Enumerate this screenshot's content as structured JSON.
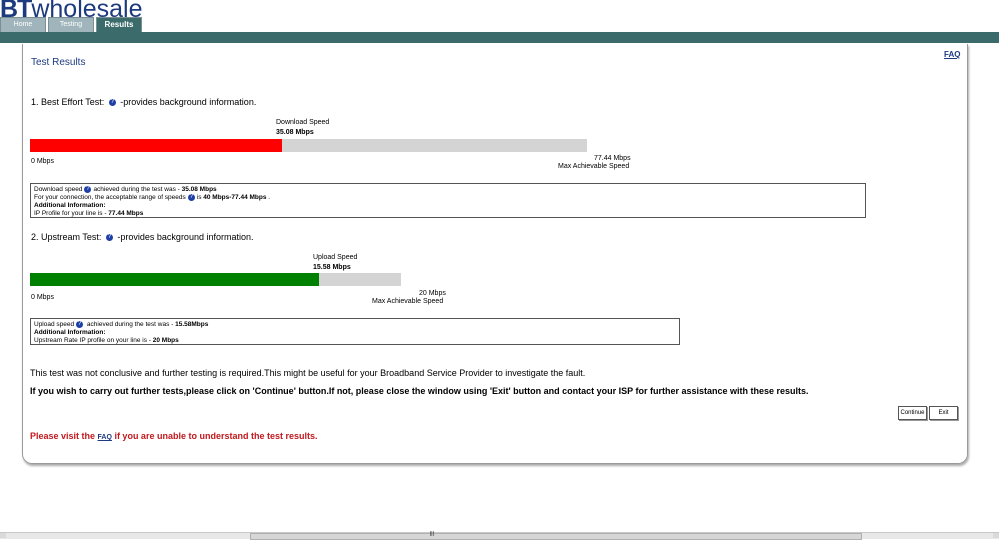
{
  "brand": {
    "bt": "BT",
    "name": "wholesale"
  },
  "tabs": [
    {
      "label": "Home"
    },
    {
      "label": "Testing"
    },
    {
      "label": "Results"
    }
  ],
  "faq_label": "FAQ",
  "title": "Test Results",
  "download": {
    "heading": "1. Best Effort Test:",
    "heading_suffix": "-provides background information.",
    "speed_label": "Download Speed",
    "speed_value": "35.08 Mbps",
    "min_label": "0 Mbps",
    "max_value": "77.44 Mbps",
    "max_label": "Max Achievable Speed",
    "fill_fraction": 0.453,
    "fill_color": "#ff0000",
    "info": {
      "line1_prefix": "Download speed",
      "line1_mid": "achieved during the test was - ",
      "line1_value": "35.08 Mbps",
      "line2_prefix": "For your connection, the acceptable range of speeds",
      "line2_mid": "is ",
      "line2_value": "40 Mbps-77.44 Mbps",
      "line2_suffix": " .",
      "line3": "Additional Information:",
      "line4_prefix": "IP Profile for your line is - ",
      "line4_value": "77.44 Mbps"
    }
  },
  "upload": {
    "heading": "2. Upstream Test:",
    "heading_suffix": "-provides background information.",
    "speed_label": "Upload Speed",
    "speed_value": "15.58 Mbps",
    "min_label": "0 Mbps",
    "max_value": "20 Mbps",
    "max_label": "Max Achievable Speed",
    "fill_fraction": 0.779,
    "fill_color": "#008000",
    "info": {
      "line1_prefix": "Upload speed",
      "line1_mid": " achieved during the test was - ",
      "line1_value": "15.58Mbps",
      "line2": "Additional Information:",
      "line3_prefix": "Upstream Rate IP profile on your line is - ",
      "line3_value": "20 Mbps"
    }
  },
  "conclusion": "This test was not conclusive and further testing is required.This might be useful for your Broadband Service Provider to investigate the fault.",
  "instruction": "If you wish to carry out further tests,please click on 'Continue' button.If not, please close the window using 'Exit' button and contact your ISP for further assistance with these results.",
  "buttons": {
    "continue": "Continue",
    "exit": "Exit"
  },
  "help": {
    "prefix": "Please visit the ",
    "link": "FAQ",
    "suffix": " if you are unable to understand the test results."
  },
  "scroll_grip": "|||"
}
